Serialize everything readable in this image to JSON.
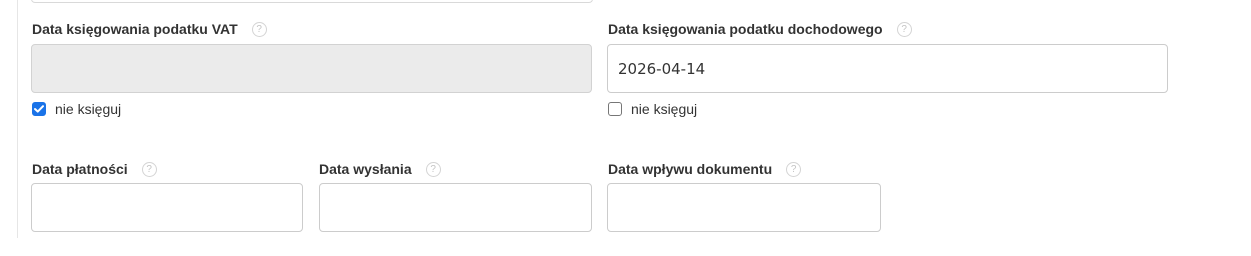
{
  "vat_booking": {
    "label": "Data księgowania podatku VAT",
    "help_glyph": "?",
    "value": "",
    "checkbox_label": "nie księguj",
    "checkbox_checked": true
  },
  "income_tax_booking": {
    "label": "Data księgowania podatku dochodowego",
    "help_glyph": "?",
    "value": "2026-04-14",
    "checkbox_label": "nie księguj",
    "checkbox_checked": false
  },
  "payment_date": {
    "label": "Data płatności",
    "help_glyph": "?",
    "value": ""
  },
  "send_date": {
    "label": "Data wysłania",
    "help_glyph": "?",
    "value": ""
  },
  "document_receipt_date": {
    "label": "Data wpływu dokumentu",
    "help_glyph": "?",
    "value": ""
  },
  "colors": {
    "accent": "#1a73e8",
    "disabled_bg": "#ebebeb",
    "border": "#cccccc"
  }
}
